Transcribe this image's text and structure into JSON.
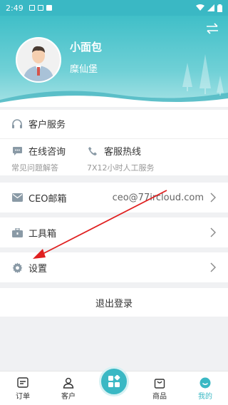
{
  "status": {
    "time": "2:49"
  },
  "profile": {
    "name": "小面包",
    "subtitle": "糜仙堡"
  },
  "service": {
    "title": "客户服务",
    "online": {
      "label": "在线咨询",
      "sub": "常见问题解答"
    },
    "hotline": {
      "label": "客服热线",
      "sub": "7X12小时人工服务"
    }
  },
  "menu": {
    "ceo_mail": {
      "label": "CEO邮箱",
      "value": "ceo@77ircloud.com"
    },
    "toolbox": {
      "label": "工具箱"
    },
    "settings": {
      "label": "设置"
    }
  },
  "logout": {
    "label": "退出登录"
  },
  "tabs": [
    {
      "label": "订单"
    },
    {
      "label": "客户"
    },
    {
      "label": ""
    },
    {
      "label": "商品"
    },
    {
      "label": "我的"
    }
  ],
  "colors": {
    "accent": "#3ab8c4",
    "arrow": "#e02020"
  }
}
